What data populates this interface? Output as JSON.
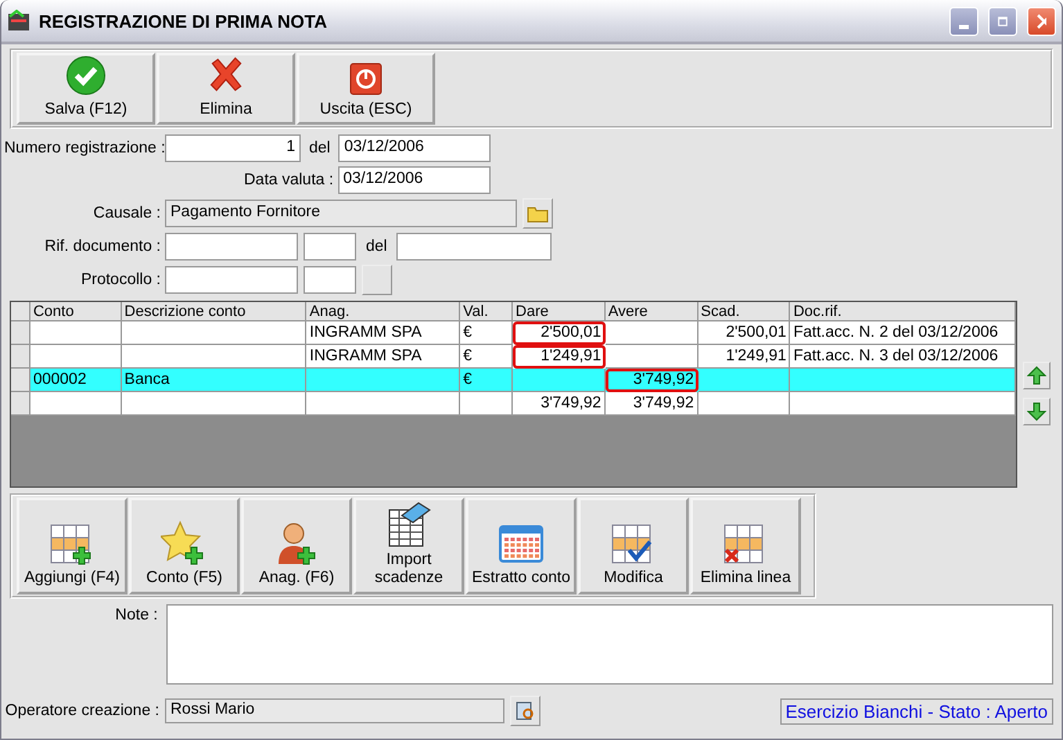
{
  "window": {
    "title": "REGISTRAZIONE DI PRIMA NOTA"
  },
  "toolbar": [
    {
      "label": "Salva (F12)"
    },
    {
      "label": "Elimina"
    },
    {
      "label": "Uscita (ESC)"
    }
  ],
  "form": {
    "numero": {
      "label": "Numero registrazione :",
      "value": "1"
    },
    "del_label": "del",
    "data": {
      "value": "03/12/2006"
    },
    "data_valuta": {
      "label": "Data valuta :",
      "value": "03/12/2006"
    },
    "causale": {
      "label": "Causale :",
      "value": "Pagamento Fornitore"
    },
    "rif_documento": {
      "label": "Rif. documento :",
      "del_label": "del"
    },
    "protocollo": {
      "label": "Protocollo :"
    }
  },
  "table": {
    "columns": [
      {
        "label": "Conto"
      },
      {
        "label": "Descrizione conto"
      },
      {
        "label": "Anag."
      },
      {
        "label": "Val."
      },
      {
        "label": "Dare"
      },
      {
        "label": "Avere"
      },
      {
        "label": "Scad."
      },
      {
        "label": "Doc.rif."
      }
    ],
    "rows": [
      {
        "selected": false,
        "cells": [
          {
            "marked": false
          },
          {
            "marked": false
          },
          {
            "text": "INGRAMM SPA",
            "marked": false
          },
          {
            "text": "€",
            "marked": false
          },
          {
            "text": "2'500,01",
            "marked": true
          },
          {
            "marked": false
          },
          {
            "text": "2'500,01",
            "marked": false
          },
          {
            "text": "Fatt.acc. N. 2 del 03/12/2006",
            "marked": false
          }
        ]
      },
      {
        "selected": false,
        "cells": [
          {
            "marked": false
          },
          {
            "marked": false
          },
          {
            "text": "INGRAMM SPA",
            "marked": false
          },
          {
            "text": "€",
            "marked": false
          },
          {
            "text": "1'249,91",
            "marked": true
          },
          {
            "marked": false
          },
          {
            "text": "1'249,91",
            "marked": false
          },
          {
            "text": "Fatt.acc. N. 3 del 03/12/2006",
            "marked": false
          }
        ]
      },
      {
        "selected": true,
        "cells": [
          {
            "text": "000002",
            "marked": false
          },
          {
            "text": "Banca",
            "marked": false
          },
          {
            "marked": false
          },
          {
            "text": "€",
            "marked": false
          },
          {
            "marked": false
          },
          {
            "text": "3'749,92",
            "marked": true
          },
          {
            "marked": false
          },
          {
            "marked": false
          }
        ]
      },
      {
        "selected": false,
        "cells": [
          {
            "marked": false
          },
          {
            "marked": false
          },
          {
            "marked": false
          },
          {
            "marked": false
          },
          {
            "text": "3'749,92",
            "marked": false
          },
          {
            "text": "3'749,92",
            "marked": false
          },
          {
            "marked": false
          },
          {
            "marked": false
          }
        ]
      }
    ]
  },
  "actions": [
    {
      "label": "Aggiungi (F4)"
    },
    {
      "label": "Conto (F5)"
    },
    {
      "label": "Anag. (F6)"
    },
    {
      "label": "Import\nscadenze"
    },
    {
      "label": "Estratto conto"
    },
    {
      "label": "Modifica"
    },
    {
      "label": "Elimina linea"
    }
  ],
  "note": {
    "label": "Note :"
  },
  "operatore": {
    "label": "Operatore creazione :",
    "value": "Rossi Mario"
  },
  "status": "Esercizio Bianchi - Stato : Aperto"
}
